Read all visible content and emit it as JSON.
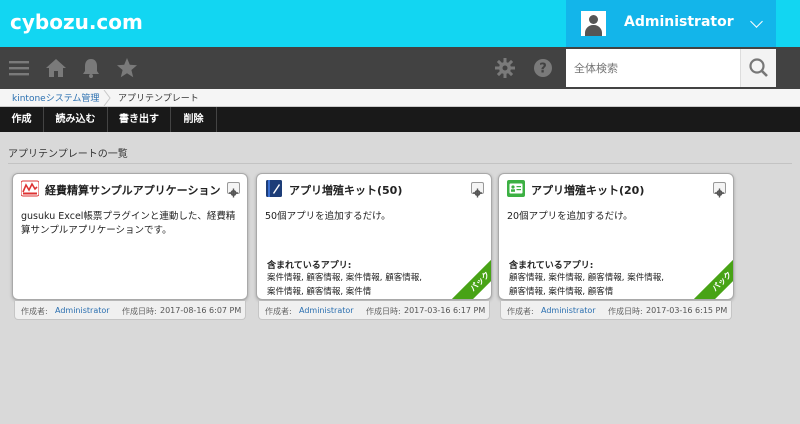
{
  "header": {
    "logo": "cybozu.com",
    "user_name": "Administrator"
  },
  "nav": {
    "icons": [
      "menu-icon",
      "home-icon",
      "bell-icon",
      "star-icon",
      "gear-icon",
      "help-icon"
    ],
    "search_placeholder": "全体検索"
  },
  "breadcrumb": {
    "root": "kintoneシステム管理",
    "current": "アプリテンプレート"
  },
  "toolbar": {
    "create": "作成",
    "import": "読み込む",
    "export": "書き出す",
    "delete": "削除"
  },
  "section_title": "アプリテンプレートの一覧",
  "cards": [
    {
      "title": "経費精算サンプルアプリケーション",
      "description": "gusuku Excel帳票プラグインと連動した、経費精算サンプルアプリケーションです。",
      "included_title": "",
      "included": "",
      "pack_label": "",
      "by_label": "作成者:",
      "author": "Administrator",
      "date_label": "作成日時:",
      "date": "2017-08-16 6:07 PM",
      "icon": "expense-app-icon"
    },
    {
      "title": "アプリ増殖キット(50)",
      "description": "50個アプリを追加するだけ。",
      "included_title": "含まれているアプリ:",
      "included": "案件情報, 顧客情報, 案件情報, 顧客情報, 案件情報, 顧客情報, 案件情",
      "pack_label": "パック",
      "by_label": "作成者:",
      "author": "Administrator",
      "date_label": "作成日時:",
      "date": "2017-03-16 6:17 PM",
      "icon": "notebook-app-icon"
    },
    {
      "title": "アプリ増殖キット(20)",
      "description": "20個アプリを追加するだけ。",
      "included_title": "含まれているアプリ:",
      "included": "顧客情報, 案件情報, 顧客情報, 案件情報, 顧客情報, 案件情報, 顧客情",
      "pack_label": "パック",
      "by_label": "作成者:",
      "author": "Administrator",
      "date_label": "作成日時:",
      "date": "2017-03-16 6:15 PM",
      "icon": "contact-card-app-icon"
    }
  ],
  "colors": {
    "header_bg": "#12d6f2",
    "user_bg": "#13b5ea",
    "nav_bg": "#424242",
    "toolbar_bg": "#191919",
    "pack_green": "#48a316",
    "link_blue": "#2a6fb0"
  }
}
